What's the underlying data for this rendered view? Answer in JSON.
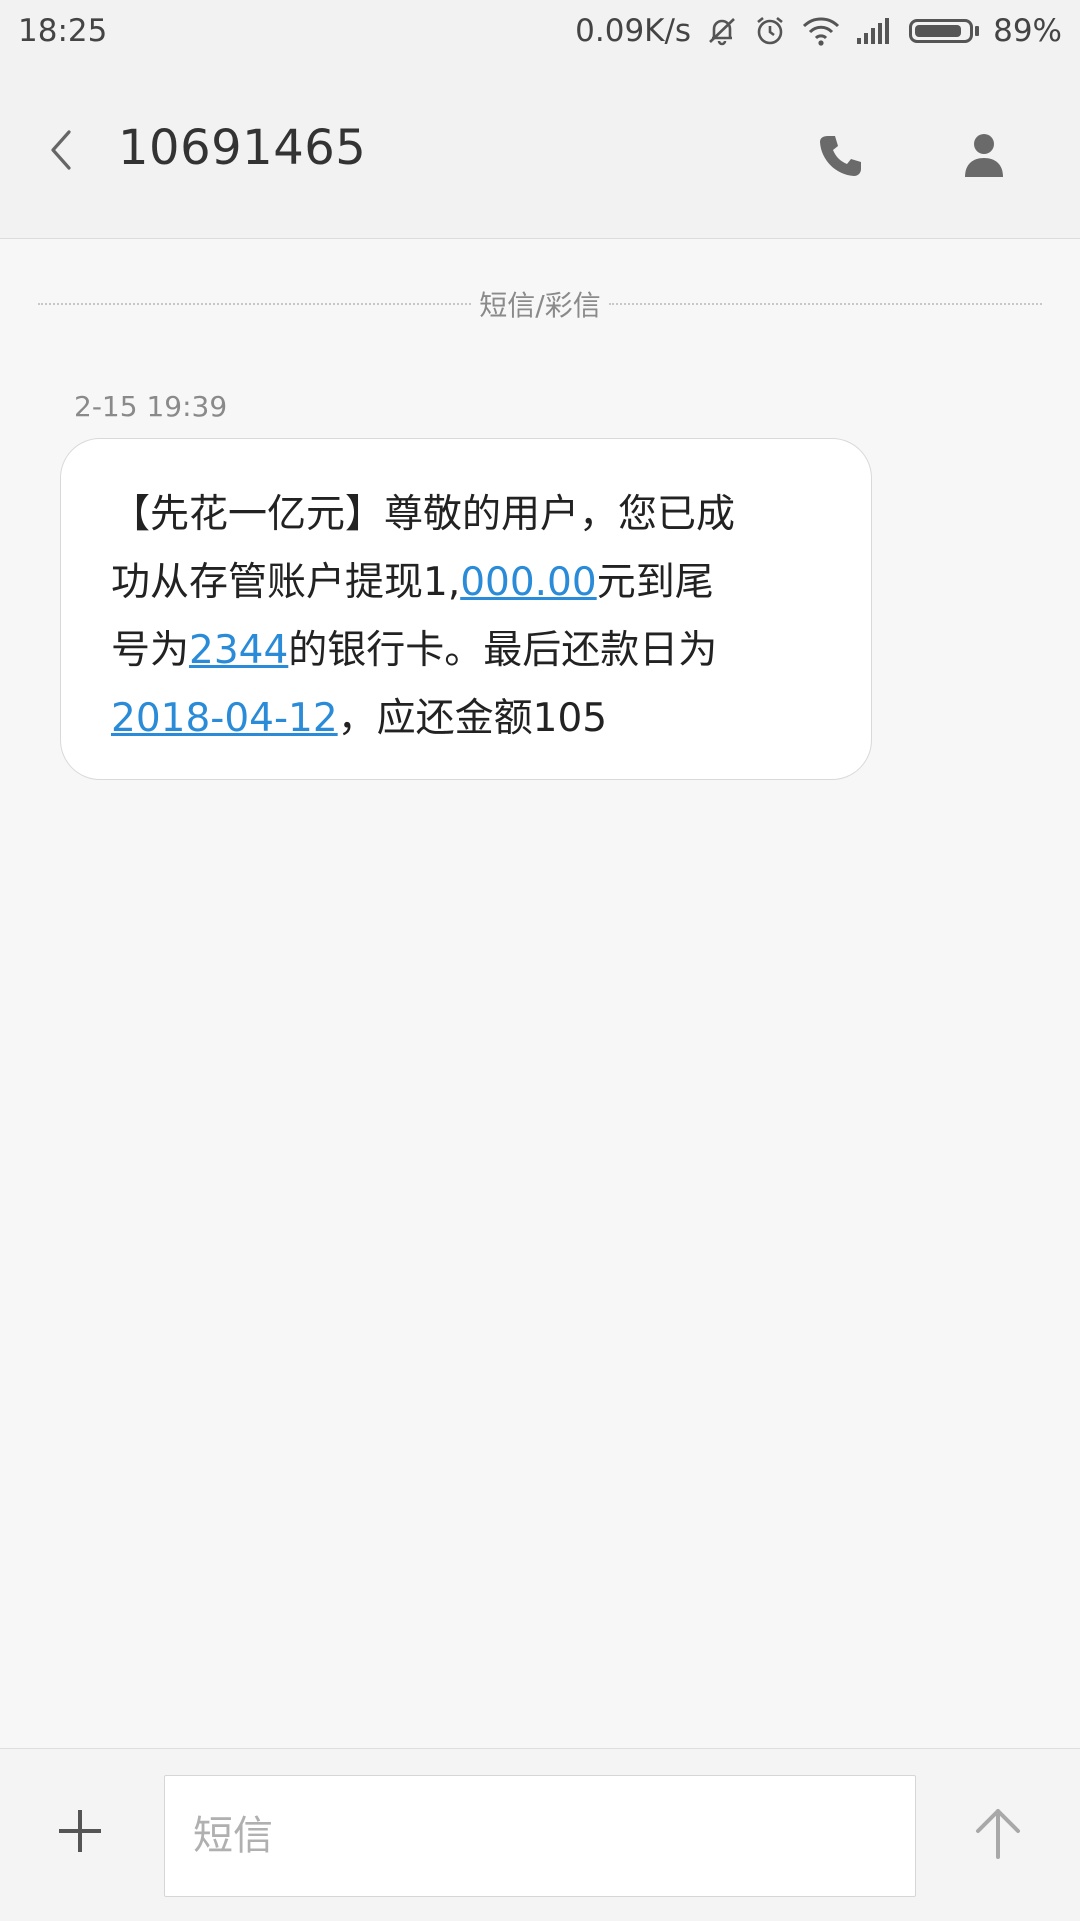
{
  "status_bar": {
    "time": "18:25",
    "network_speed": "0.09K/s",
    "battery_percent": "89%",
    "battery_level": 0.89,
    "icons": [
      "mute-icon",
      "alarm-icon",
      "wifi-icon",
      "signal-icon",
      "battery-icon"
    ]
  },
  "header": {
    "title": "10691465",
    "icons": [
      "back-icon",
      "phone-icon",
      "contact-icon"
    ]
  },
  "conversation": {
    "channel_label": "短信/彩信",
    "messages": [
      {
        "time": "2-15 19:39",
        "lines": [
          {
            "parts": [
              "【先花一亿元】尊敬的用户，您已成"
            ]
          },
          {
            "parts": [
              "功从存管账户提现1,",
              "000.00",
              "元到尾"
            ]
          },
          {
            "parts": [
              "号为",
              "2344",
              "的银行卡。最后还款日为"
            ]
          },
          {
            "parts": [
              "2018-04-12",
              "，应还金额105"
            ]
          }
        ]
      }
    ]
  },
  "compose": {
    "placeholder": "短信",
    "icons": [
      "plus-icon",
      "send-arrow-icon"
    ]
  },
  "colors": {
    "link": "#2a8bd8",
    "background": "#f7f7f8",
    "bubble": "#ffffff"
  }
}
